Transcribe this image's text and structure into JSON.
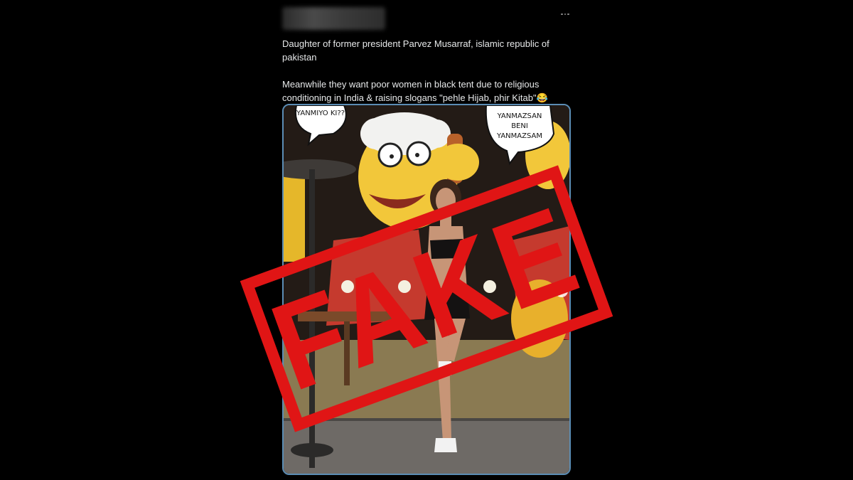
{
  "tweet": {
    "text_line_1": "Daughter of former president Parvez Musarraf,  islamic republic of pakistan",
    "text_line_2": "Meanwhile they want poor women in black tent due to religious conditioning in India & raising slogans \"pehle Hijab, phir Kitab\"",
    "emoji": "😂",
    "more_icon": "more-horizontal-icon"
  },
  "mural": {
    "bubble_left": "YANMIYO KI??",
    "bubble_right_line_1": "YANMAZSAN",
    "bubble_right_line_2": "BENI",
    "bubble_right_line_3": "YANMAZSAM"
  },
  "carousel": {
    "next_glyph": "›"
  },
  "stamp": {
    "label": "FAKE",
    "color": "#e01515"
  },
  "colors": {
    "background": "#000000",
    "text": "#e7e9ea",
    "media_border": "#5b8db5"
  }
}
